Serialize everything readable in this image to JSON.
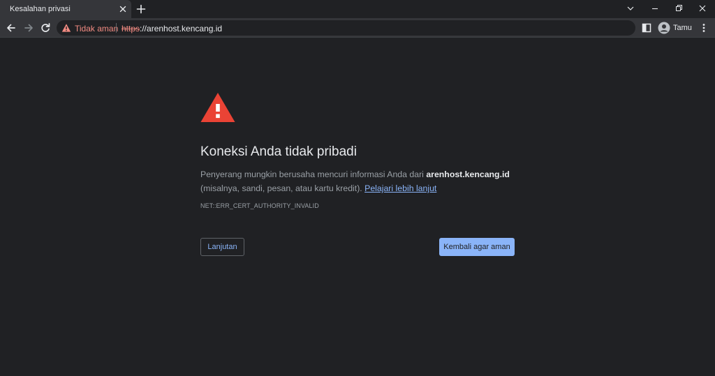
{
  "tab": {
    "title": "Kesalahan privasi"
  },
  "omnibox": {
    "security_label": "Tidak aman",
    "url_scheme": "https",
    "url_rest": "://arenhost.kencang.id"
  },
  "profile": {
    "name": "Tamu"
  },
  "interstitial": {
    "heading": "Koneksi Anda tidak pribadi",
    "para_prefix": "Penyerang mungkin berusaha mencuri informasi Anda dari ",
    "host": "arenhost.kencang.id",
    "para_suffix": " (misalnya, sandi, pesan, atau kartu kredit). ",
    "learn_more": "Pelajari lebih lanjut",
    "error_code": "NET::ERR_CERT_AUTHORITY_INVALID",
    "advanced_label": "Lanjutan",
    "back_label": "Kembali agar aman"
  },
  "colors": {
    "background": "#202124",
    "warning_red": "#ea4335",
    "link_blue": "#8ab4f8"
  },
  "icons": [
    "close-icon",
    "plus-icon",
    "chevron-down-icon",
    "minimize-icon",
    "restore-icon",
    "close-window-icon",
    "back-arrow-icon",
    "forward-arrow-icon",
    "reload-icon",
    "warning-triangle-icon",
    "side-panel-icon",
    "avatar-icon",
    "kebab-menu-icon"
  ]
}
